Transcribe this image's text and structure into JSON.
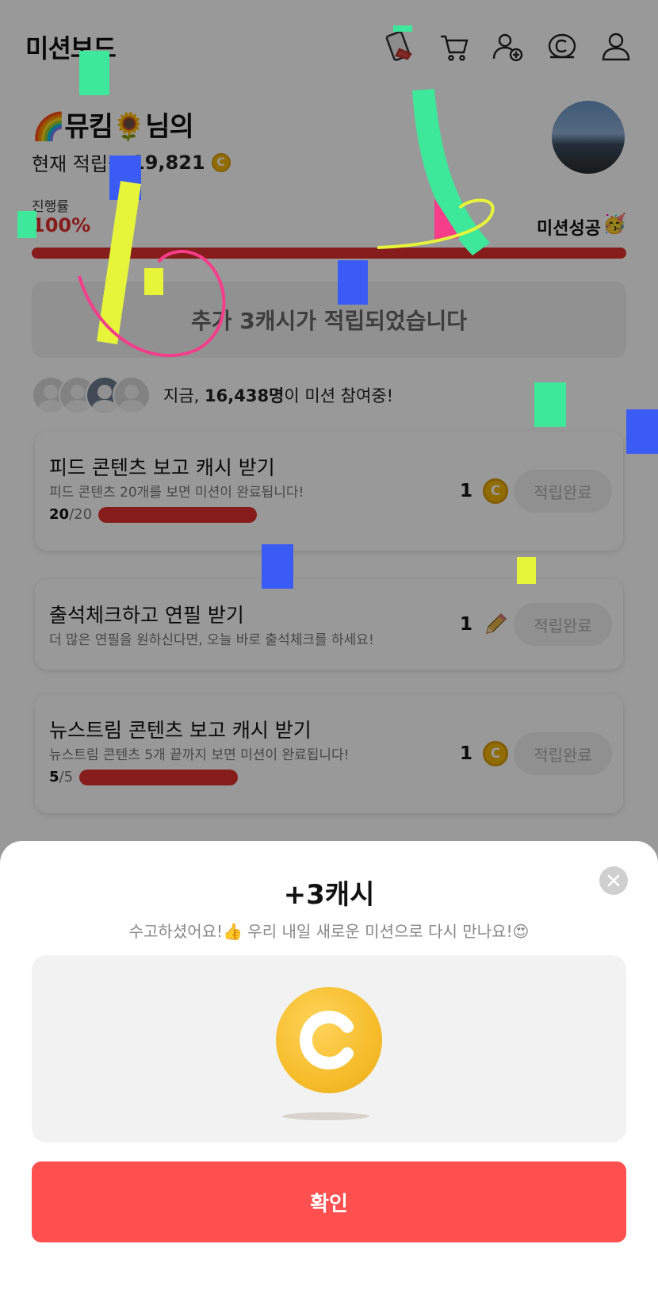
{
  "header": {
    "title": "미션보드",
    "icons": [
      "phone-swipe-icon",
      "cart-icon",
      "add-user-icon",
      "cash-coin-icon",
      "profile-icon"
    ]
  },
  "profile": {
    "name_prefix_emoji": "🌈",
    "name": "뮤킴",
    "name_suffix_emoji": "🌻",
    "name_suffix": "님의",
    "points_label": "현재 적립금",
    "points_value": "19,821",
    "coin_symbol": "C"
  },
  "progress": {
    "label": "진행률",
    "percent_text": "100%",
    "percent": 100,
    "success_label": "미션성공",
    "success_emoji": "🥳"
  },
  "notice": {
    "text": "추가 3캐시가 적립되었습니다"
  },
  "participants": {
    "prefix": "지금,",
    "count": "16,438명",
    "suffix": "이 미션 참여중!"
  },
  "missions": [
    {
      "title": "피드 콘텐츠 보고 캐시 받기",
      "desc": "피드 콘텐츠 20개를 보면 미션이 완료됩니다!",
      "done": "20",
      "total": "/20",
      "progress": 1.0,
      "reward": "1",
      "reward_icon": "cash-coin-icon",
      "button": "적립완료"
    },
    {
      "title": "출석체크하고 연필 받기",
      "desc": "더 많은 연필을 원하신다면, 오늘 바로 출석체크를 하세요!",
      "reward": "1",
      "reward_icon": "pencil-icon",
      "button": "적립완료"
    },
    {
      "title": "뉴스트림 콘텐츠 보고 캐시 받기",
      "desc": "뉴스트림 콘텐츠 5개 끝까지 보면 미션이 완료됩니다!",
      "done": "5",
      "total": "/5",
      "progress": 1.0,
      "reward": "1",
      "reward_icon": "cash-coin-icon",
      "button": "적립완료"
    }
  ],
  "sheet": {
    "title": "+3캐시",
    "subtitle": "수고하셨어요!👍 우리 내일 새로운 미션으로 다시 만나요!😍",
    "confirm": "확인"
  },
  "colors": {
    "accent_red": "#e0312f",
    "confirm_red": "#ff4f4f",
    "coin_gold": "#f6bd2c"
  }
}
